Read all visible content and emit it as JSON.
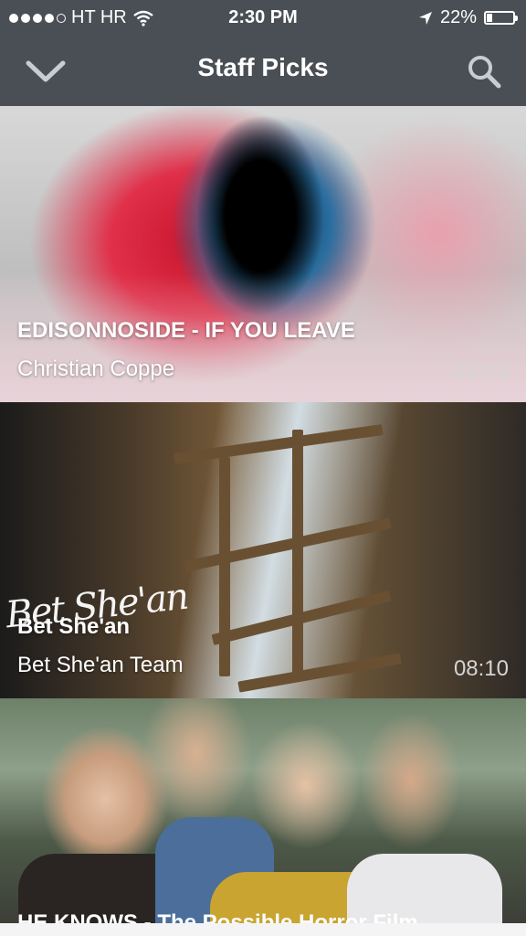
{
  "status_bar": {
    "carrier": "HT HR",
    "time": "2:30 PM",
    "battery_percent": "22%",
    "battery_level": 0.22
  },
  "nav": {
    "title": "Staff Picks",
    "icons": {
      "collapse": "chevron-down-icon",
      "search": "search-icon"
    }
  },
  "videos": [
    {
      "title": "EDISONNOSIDE - IF YOU LEAVE",
      "author": "Christian Coppe",
      "duration": "04:03"
    },
    {
      "title": "Bet She'an",
      "logo_text": "Bet She'an",
      "author": "Bet She'an Team",
      "duration": "08:10"
    },
    {
      "title": "HE KNOWS - The Possible Horror Film",
      "author": "",
      "duration": ""
    }
  ],
  "colors": {
    "bar": "#4a4f55",
    "text": "#ffffff",
    "duration": "#d5d5d5"
  }
}
